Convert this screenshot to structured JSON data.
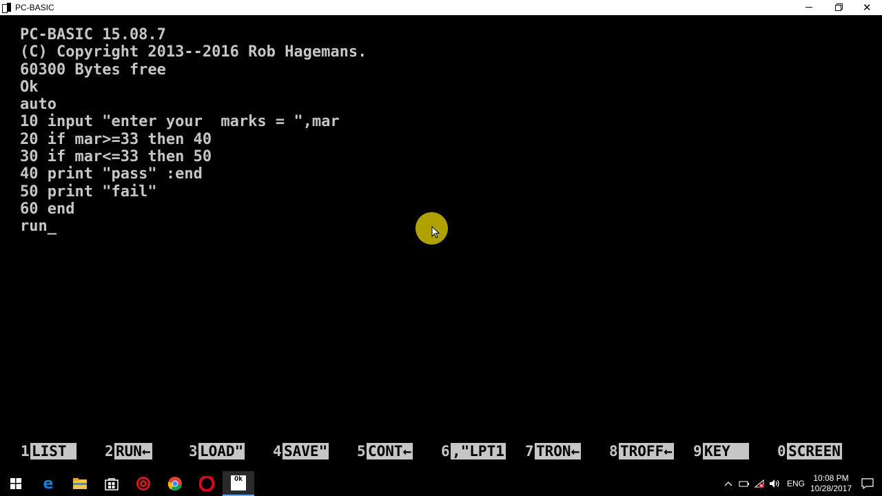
{
  "window": {
    "title": "PC-BASIC"
  },
  "console": {
    "lines": [
      "PC-BASIC 15.08.7",
      "(C) Copyright 2013--2016 Rob Hagemans.",
      "60300 Bytes free",
      "Ok",
      "auto",
      "10 input \"enter your  marks = \",mar",
      "20 if mar>=33 then 40",
      "30 if mar<=33 then 50",
      "40 print \"pass\" :end",
      "50 print \"fail\"",
      "60 end",
      "run_"
    ]
  },
  "function_keys": [
    {
      "num": "1",
      "label": "LIST "
    },
    {
      "num": "2",
      "label": "RUN←"
    },
    {
      "num": "3",
      "label": "LOAD\""
    },
    {
      "num": "4",
      "label": "SAVE\""
    },
    {
      "num": "5",
      "label": "CONT←"
    },
    {
      "num": "6",
      "label": ",\"LPT1"
    },
    {
      "num": "7",
      "label": "TRON←"
    },
    {
      "num": "8",
      "label": "TROFF←"
    },
    {
      "num": "9",
      "label": "KEY  "
    },
    {
      "num": "0",
      "label": "SCREEN"
    }
  ],
  "taskbar": {
    "apps": [
      "windows-start",
      "edge",
      "file-explorer",
      "store",
      "settings-red",
      "chrome",
      "opera",
      "pc-basic"
    ],
    "active_app_label": "Ok",
    "language": "ENG",
    "time": "10:08 PM",
    "date": "10/28/2017"
  },
  "colors": {
    "console_text": "#c6c6c6",
    "console_bg": "#000000",
    "cursor_highlight": "#c2b300"
  }
}
